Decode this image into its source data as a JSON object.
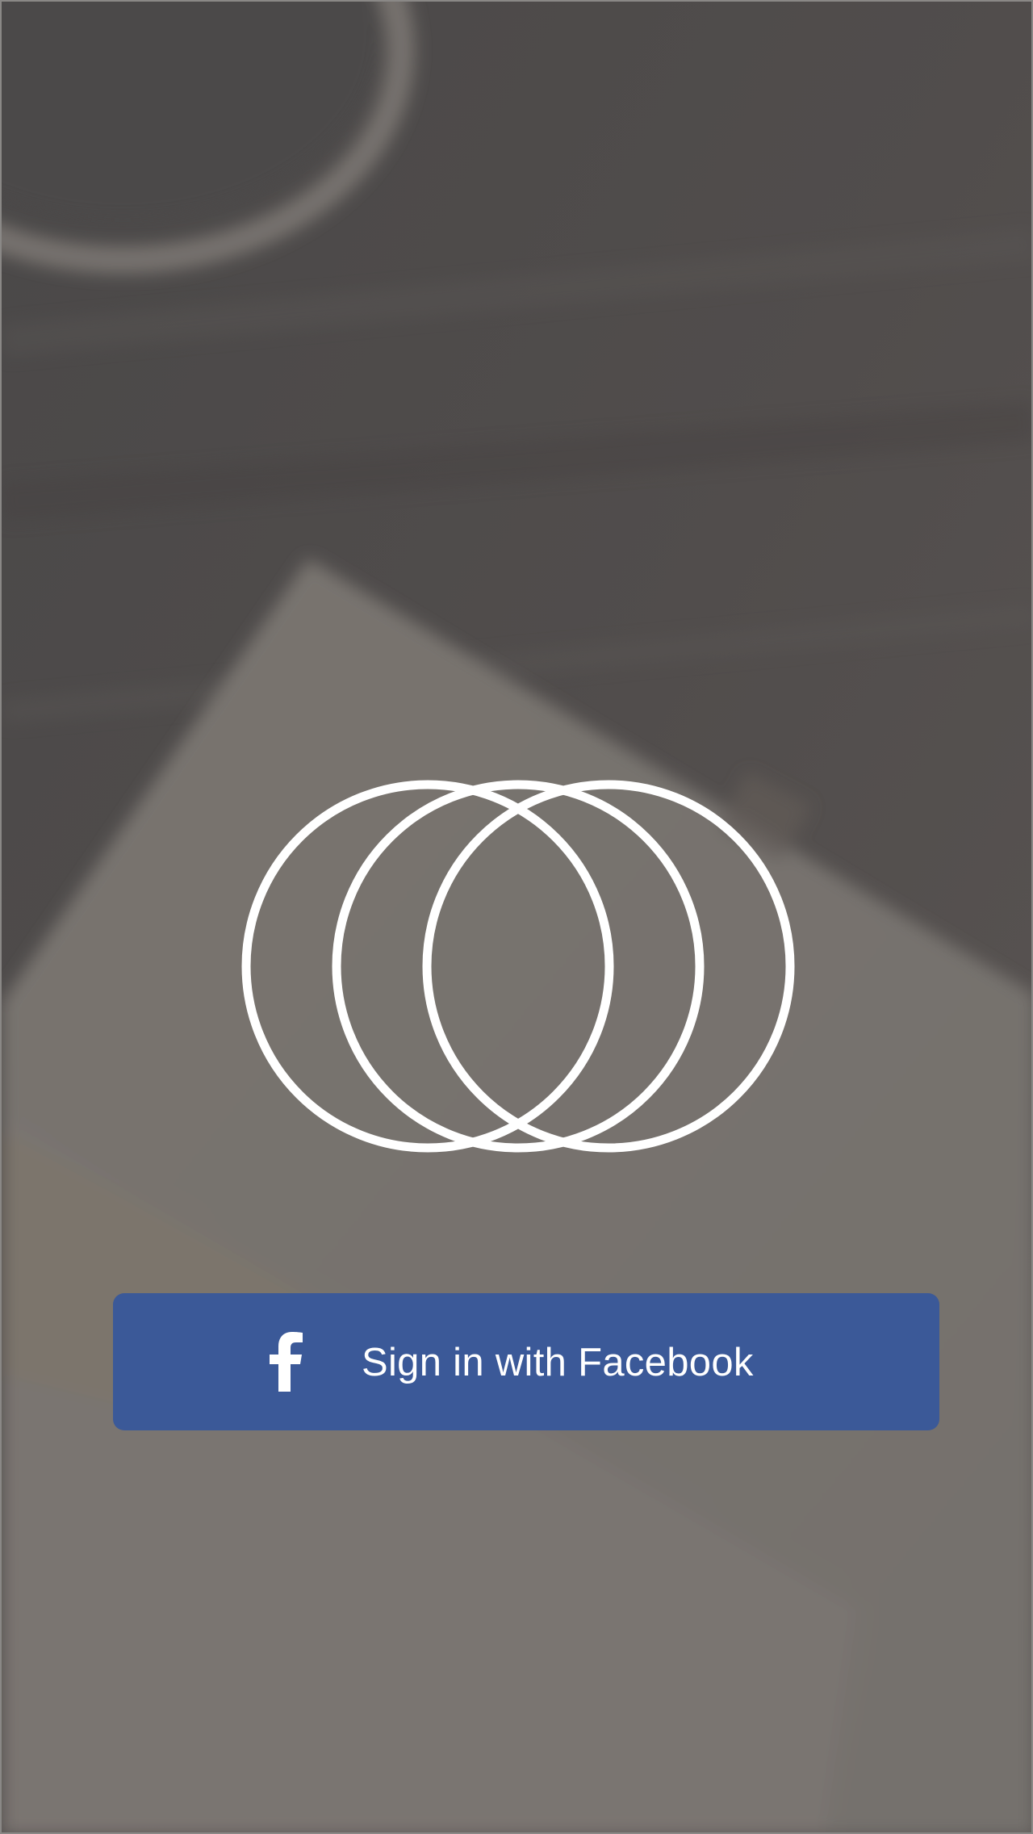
{
  "colors": {
    "facebook_button": "#3b5998",
    "logo_stroke": "#ffffff",
    "label_text": "#ffffff",
    "overlay": "#4a4747"
  },
  "logo": {
    "icon": "three-overlapping-rings-logo"
  },
  "login": {
    "facebook_icon": "facebook-f-icon",
    "facebook_label": "Sign in with Facebook"
  }
}
